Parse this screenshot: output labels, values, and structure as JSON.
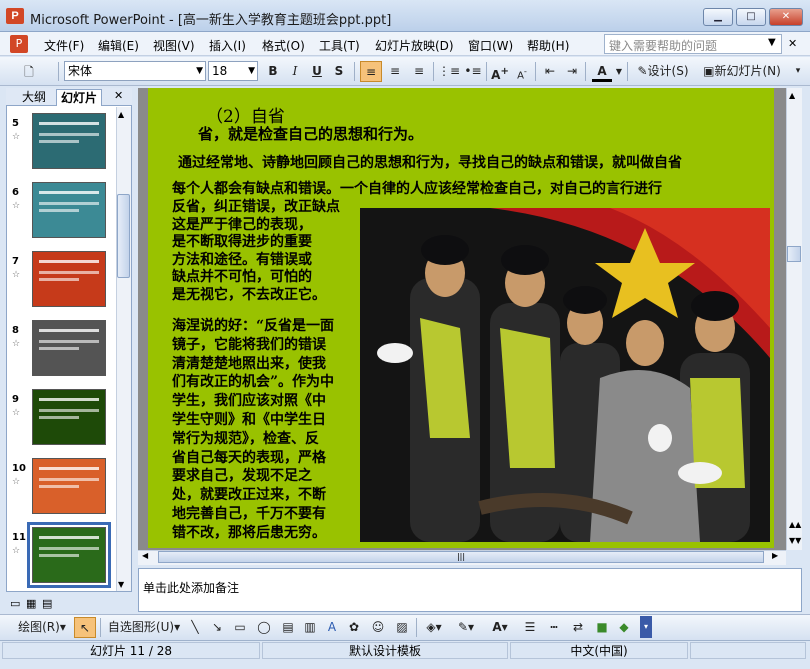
{
  "window": {
    "title": "Microsoft PowerPoint - [高一新生入学教育主题班会ppt.ppt]",
    "icon": "powerpoint-icon"
  },
  "menu": {
    "items": [
      "文件(F)",
      "编辑(E)",
      "视图(V)",
      "插入(I)",
      "格式(O)",
      "工具(T)",
      "幻灯片放映(D)",
      "窗口(W)",
      "帮助(H)"
    ],
    "help_placeholder": "键入需要帮助的问题"
  },
  "toolbar": {
    "font": "宋体",
    "size": "18",
    "design": "设计(S)",
    "new_slide": "新幻灯片(N)"
  },
  "left_pane": {
    "tab_outline": "大纲",
    "tab_slides": "幻灯片",
    "thumbs": [
      "5",
      "6",
      "7",
      "8",
      "9",
      "10",
      "11"
    ],
    "thumb_colors": [
      "#2c6b73",
      "#3c8a95",
      "#c63a1a",
      "#545454",
      "#1e4a08",
      "#d9602a",
      "#2a6a1a"
    ],
    "selected": "11"
  },
  "slide": {
    "heading": "（2）自省",
    "sub": "省，就是检查自己的思想和行为。",
    "p1": "通过经常地、诗静地回顾自己的思想和行为，寻找自己的缺点和错误，就叫做自省",
    "p2": "每个人都会有缺点和错误。一个自律的人应该经常检查自己，对自己的言行进行",
    "p3": [
      "反省，纠正错误，改正缺点",
      "这是严于律己的表现，",
      "是不断取得进步的重要",
      "方法和途径。有错误或",
      "缺点并不可怕，可怕的",
      "是无视它，不去改正它。"
    ],
    "p4": [
      "海涅说的好：“反省是一面",
      "镜子，它能将我们的错误",
      "清清楚楚地照出来，使我",
      "们有改正的机会”。作为中",
      "学生，我们应该对照《中",
      "学生守则》和《中学生日",
      "常行为规范》，检查、反",
      "省自己每天的表现，严格",
      "要求自己，发现不足之",
      "处，就要改正过来，不断",
      "地完善自己，千万不要有",
      "错不改，那将后患无穷。"
    ]
  },
  "notes": {
    "placeholder": "单击此处添加备注"
  },
  "drawbar": {
    "draw": "绘图(R)",
    "autoshape": "自选图形(U)"
  },
  "status": {
    "slide": "幻灯片 11 / 28",
    "template": "默认设计模板",
    "lang": "中文(中国)"
  }
}
